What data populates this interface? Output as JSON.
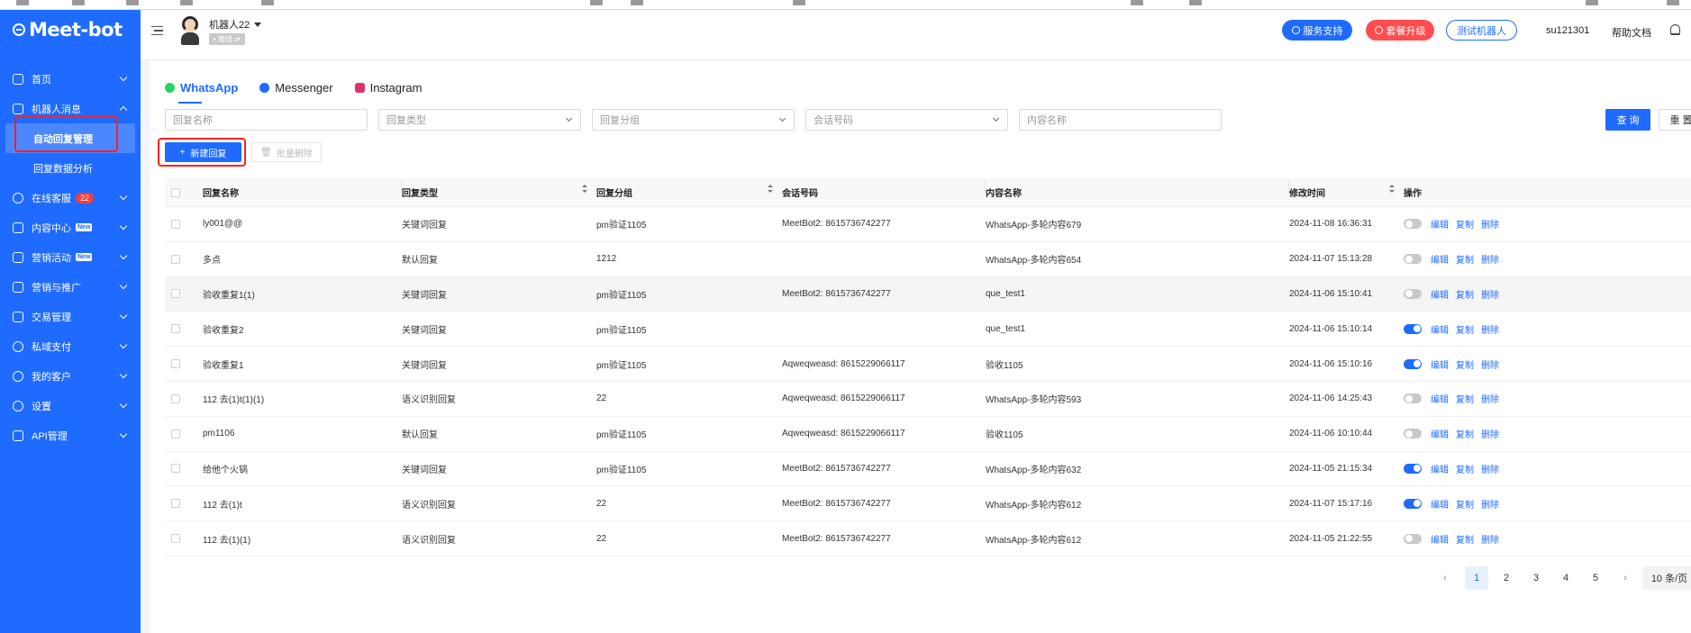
{
  "sidebar": {
    "brand": "Meet-bot",
    "nav": [
      {
        "label": "首页",
        "icon": "home-icon"
      },
      {
        "label": "机器人消息",
        "icon": "robot-message-icon",
        "expanded": true,
        "children": [
          {
            "label": "自动回复管理",
            "active": true
          },
          {
            "label": "回复数据分析",
            "active": false
          }
        ]
      },
      {
        "label": "在线客服",
        "icon": "headset-icon",
        "badge": "22"
      },
      {
        "label": "内容中心",
        "icon": "content-icon",
        "tag": "New"
      },
      {
        "label": "营销活动",
        "icon": "campaign-icon",
        "tag": "New"
      },
      {
        "label": "营销与推广",
        "icon": "send-icon"
      },
      {
        "label": "交易管理",
        "icon": "bag-icon"
      },
      {
        "label": "私域支付",
        "icon": "payment-icon"
      },
      {
        "label": "我的客户",
        "icon": "customers-icon"
      },
      {
        "label": "设置",
        "icon": "settings-icon"
      },
      {
        "label": "API管理",
        "icon": "api-icon"
      }
    ]
  },
  "header": {
    "bot_name": "机器人22",
    "bot_status": "• 离线 ⇄",
    "support_label": "服务支持",
    "upgrade_label": "套餐升级",
    "test_label": "测试机器人",
    "username": "su121301",
    "help_label": "帮助文档"
  },
  "tabs": [
    {
      "label": "WhatsApp",
      "active": true,
      "color": "#25d366"
    },
    {
      "label": "Messenger",
      "active": false,
      "color": "#1f6bff"
    },
    {
      "label": "Instagram",
      "active": false,
      "color": "#e1306c"
    }
  ],
  "filters": {
    "reply_name": "回复名称",
    "reply_type": "回复类型",
    "reply_group": "回复分组",
    "session_number": "会话号码",
    "content_name": "内容名称",
    "query_label": "查 询",
    "reset_label": "重 置"
  },
  "actions": {
    "new_label": "新建回复",
    "batch_delete_label": "批量删除"
  },
  "table": {
    "columns": [
      "回复名称",
      "回复类型",
      "回复分组",
      "会话号码",
      "内容名称",
      "修改时间",
      "操作"
    ],
    "row_actions": {
      "edit": "编辑",
      "copy": "复制",
      "delete": "删除"
    },
    "rows": [
      {
        "name": "ly001@@",
        "type": "关键词回复",
        "group": "pm验证1105",
        "session": "MeetBot2: 8615736742277",
        "content": "WhatsApp-多轮内容679",
        "time": "2024-11-08 16:36:31",
        "enabled": false
      },
      {
        "name": "多点",
        "type": "默认回复",
        "group": "1212",
        "session": "",
        "content": "WhatsApp-多轮内容654",
        "time": "2024-11-07 15:13:28",
        "enabled": false
      },
      {
        "name": "验收重复1(1)",
        "type": "关键词回复",
        "group": "pm验证1105",
        "session": "MeetBot2: 8615736742277",
        "content": "que_test1",
        "time": "2024-11-06 15:10:41",
        "enabled": false
      },
      {
        "name": "验收重复2",
        "type": "关键词回复",
        "group": "pm验证1105",
        "session": "",
        "content": "que_test1",
        "time": "2024-11-06 15:10:14",
        "enabled": true
      },
      {
        "name": "验收重复1",
        "type": "关键词回复",
        "group": "pm验证1105",
        "session": "Aqweqweasd: 8615229066117",
        "content": "验收1105",
        "time": "2024-11-06 15:10:16",
        "enabled": true
      },
      {
        "name": "112 去(1)t(1)(1)",
        "type": "语义识别回复",
        "group": "22",
        "session": "Aqweqweasd: 8615229066117",
        "content": "WhatsApp-多轮内容593",
        "time": "2024-11-06 14:25:43",
        "enabled": false
      },
      {
        "name": "pm1106",
        "type": "默认回复",
        "group": "pm验证1105",
        "session": "Aqweqweasd: 8615229066117",
        "content": "验收1105",
        "time": "2024-11-06 10:10:44",
        "enabled": false
      },
      {
        "name": "给他个火锅",
        "type": "关键词回复",
        "group": "pm验证1105",
        "session": "MeetBot2: 8615736742277",
        "content": "WhatsApp-多轮内容632",
        "time": "2024-11-05 21:15:34",
        "enabled": true
      },
      {
        "name": "112 去(1)t",
        "type": "语义识别回复",
        "group": "22",
        "session": "MeetBot2: 8615736742277",
        "content": "WhatsApp-多轮内容612",
        "time": "2024-11-07 15:17:16",
        "enabled": true
      },
      {
        "name": "112 去(1)(1)",
        "type": "语义识别回复",
        "group": "22",
        "session": "MeetBot2: 8615736742277",
        "content": "WhatsApp-多轮内容612",
        "time": "2024-11-05 21:22:55",
        "enabled": false
      }
    ]
  },
  "pagination": {
    "pages": [
      "1",
      "2",
      "3",
      "4",
      "5"
    ],
    "current": "1",
    "prev": "‹",
    "next": "›",
    "page_size": "10 条/页"
  },
  "colors": {
    "primary": "#1f6bff",
    "danger": "#ff4d4f",
    "highlight_box": "#ff2020"
  }
}
